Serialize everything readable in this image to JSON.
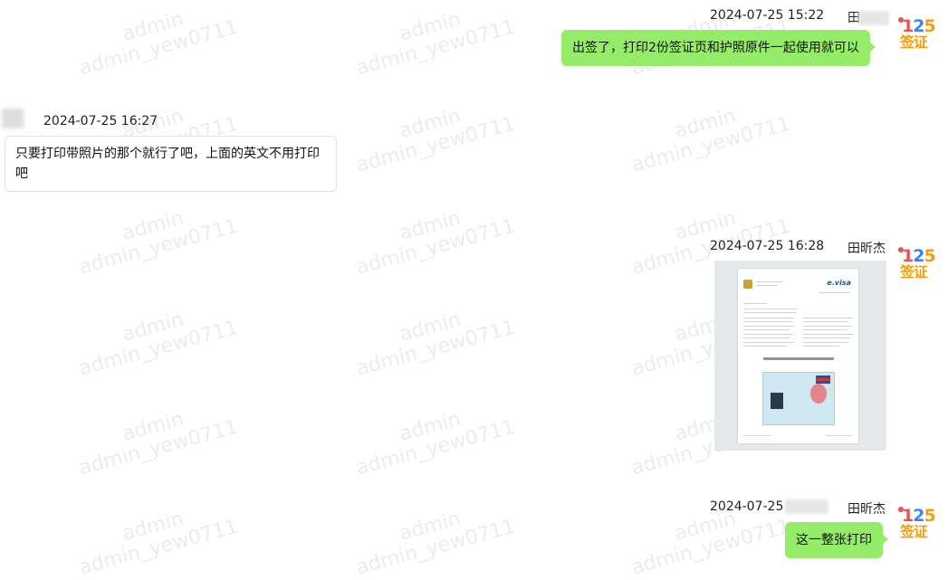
{
  "watermark": {
    "line1": "admin",
    "line2": "admin_yew0711"
  },
  "messages": [
    {
      "direction": "outgoing",
      "timestamp": "2024-07-25 15:22",
      "sender_name": "田",
      "text": "出签了，打印2份签证页和护照原件一起使用就可以"
    },
    {
      "direction": "incoming",
      "timestamp": "2024-07-25 16:27",
      "text": "只要打印带照片的那个就行了吧，上面的英文不用打印吧"
    },
    {
      "direction": "outgoing",
      "timestamp": "2024-07-25 16:28",
      "sender_name": "田昕杰",
      "type": "image",
      "image_label": "visa document preview"
    },
    {
      "direction": "outgoing",
      "timestamp": "2024-07-25",
      "sender_name": "田昕杰",
      "text": "这一整张打印"
    }
  ],
  "avatar": {
    "brand_number": "125",
    "brand_text": "签证",
    "icon": "125-visa-logo-icon"
  },
  "document_preview": {
    "brand": "e.visa"
  },
  "colors": {
    "outgoing_bubble": "#95ec69",
    "incoming_bubble": "#ffffff",
    "background": "#ffffff"
  }
}
